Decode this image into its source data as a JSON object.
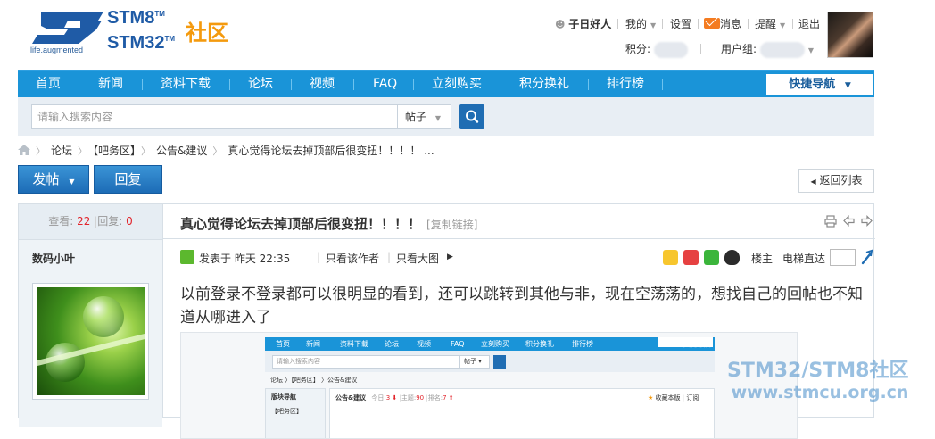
{
  "logo": {
    "tagline": "life.augmented",
    "stm8": "STM8",
    "stm32": "STM32",
    "tm": "TM",
    "community": "社区"
  },
  "topbar": {
    "username": "子日好人",
    "my": "我的",
    "settings": "设置",
    "messages": "消息",
    "remind": "提醒",
    "logout": "退出",
    "points_label": "积分:",
    "group_label": "用户组:"
  },
  "nav": {
    "items": [
      "首页",
      "新闻",
      "资料下载",
      "论坛",
      "视频",
      "FAQ",
      "立刻购买",
      "积分换礼",
      "排行榜"
    ],
    "quick_nav": "快捷导航"
  },
  "search": {
    "placeholder": "请输入搜索内容",
    "type": "帖子"
  },
  "breadcrumb": {
    "items": [
      "论坛",
      "【吧务区】",
      "公告&建议",
      "真心觉得论坛去掉顶部后很变扭！！！！ ..."
    ]
  },
  "actions": {
    "post": "发帖",
    "reply": "回复",
    "back_to_list": "返回列表"
  },
  "thread": {
    "views_label": "查看:",
    "views": "22",
    "replies_label": "回复:",
    "replies": "0",
    "title": "真心觉得论坛去掉顶部后很变扭！！！！",
    "copy_link": "[复制链接]",
    "author": "数码小叶",
    "posted_prefix": "发表于",
    "posted_time": "昨天 22:35",
    "only_author": "只看该作者",
    "big_image": "只看大图",
    "floor": "楼主",
    "elevator": "电梯直达",
    "content": "以前登录不登录都可以很明显的看到，还可以跳转到其他与非，现在空荡荡的，想找自己的回帖也不知道从哪进入了"
  },
  "embedded": {
    "nav": [
      "首页",
      "新闻",
      "资料下载",
      "论坛",
      "视频",
      "FAQ",
      "立刻购买",
      "积分换礼",
      "排行榜"
    ],
    "quick_nav": "快捷导航",
    "search_placeholder": "请输入搜索内容",
    "search_type": "帖子",
    "crumb": "论坛 〉【吧务区】 〉公告&建议",
    "side_title": "版块导航",
    "side_item": "【吧务区】",
    "main_title": "公告&建议",
    "today_label": "今日:",
    "today": "3",
    "topics_label": "主题:",
    "topics": "90",
    "rank_label": "排名:",
    "rank": "7",
    "fav": "收藏本版",
    "subscribe": "订阅"
  },
  "watermark": {
    "line1": "STM32/STM8社区",
    "line2": "www.stmcu.org.cn"
  },
  "colors": {
    "nav_blue": "#1a94d8",
    "button_blue": "#1d6cb6",
    "accent_red": "#e2242b",
    "logo_orange": "#f49a0e"
  }
}
